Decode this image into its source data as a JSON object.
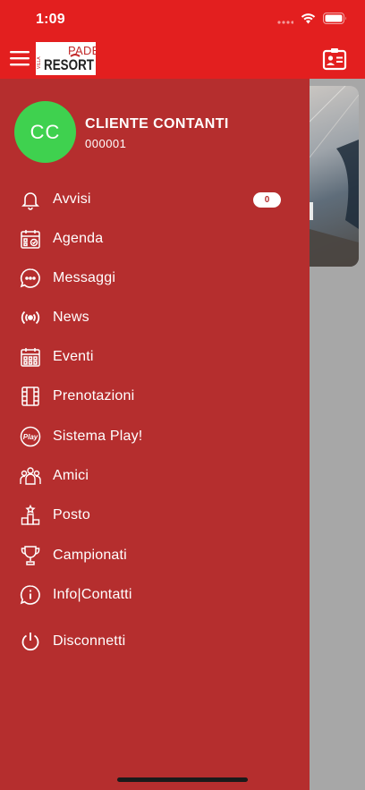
{
  "status_bar": {
    "time": "1:09"
  },
  "header": {
    "logo_top": "PADEL",
    "logo_main": "RESORT",
    "logo_side": "VILLA"
  },
  "profile": {
    "initials": "CC",
    "name": "CLIENTE CONTANTI",
    "code": "000001"
  },
  "menu": [
    {
      "label": "Avvisi",
      "icon": "bell-icon",
      "counter": "0"
    },
    {
      "label": "Agenda",
      "icon": "calendar-check-icon"
    },
    {
      "label": "Messaggi",
      "icon": "chat-bubble-icon"
    },
    {
      "label": "News",
      "icon": "broadcast-icon"
    },
    {
      "label": "Eventi",
      "icon": "calendar-grid-icon"
    },
    {
      "label": "Prenotazioni",
      "icon": "film-strip-icon"
    },
    {
      "label": "Sistema Play!",
      "icon": "play-badge-icon"
    },
    {
      "label": "Amici",
      "icon": "group-icon"
    },
    {
      "label": "Posto",
      "icon": "podium-icon"
    },
    {
      "label": "Campionati",
      "icon": "trophy-icon"
    },
    {
      "label": "Info|Contatti",
      "icon": "info-bubble-icon"
    },
    {
      "label": "Disconnetti",
      "icon": "power-icon"
    }
  ],
  "colors": {
    "header_red": "#e31f1f",
    "drawer_red": "#b52e2e",
    "avatar_green": "#3fd14f"
  }
}
